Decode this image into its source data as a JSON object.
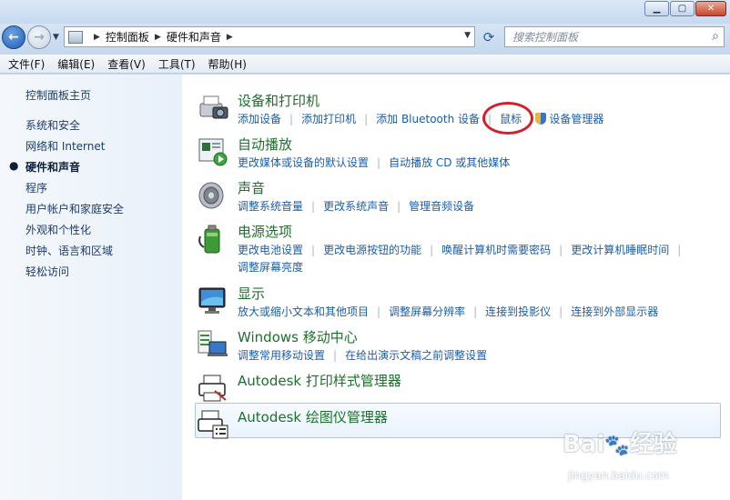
{
  "window": {
    "controls": [
      "minimize-icon",
      "maximize-icon",
      "close-icon"
    ]
  },
  "navbar": {
    "back_icon": "back-arrow-icon",
    "forward_icon": "forward-arrow-icon",
    "breadcrumb": [
      "控制面板",
      "硬件和声音"
    ],
    "search_placeholder": "搜索控制面板"
  },
  "menu": [
    "文件(F)",
    "编辑(E)",
    "查看(V)",
    "工具(T)",
    "帮助(H)"
  ],
  "sidebar": {
    "home": "控制面板主页",
    "items": [
      {
        "label": "系统和安全",
        "active": false
      },
      {
        "label": "网络和 Internet",
        "active": false
      },
      {
        "label": "硬件和声音",
        "active": true
      },
      {
        "label": "程序",
        "active": false
      },
      {
        "label": "用户帐户和家庭安全",
        "active": false
      },
      {
        "label": "外观和个性化",
        "active": false
      },
      {
        "label": "时钟、语言和区域",
        "active": false
      },
      {
        "label": "轻松访问",
        "active": false
      }
    ]
  },
  "categories": [
    {
      "title": "设备和打印机",
      "icon": "printer-camera-icon",
      "links": [
        "添加设备",
        "添加打印机",
        "添加 Bluetooth 设备",
        "鼠标",
        "设备管理器"
      ]
    },
    {
      "title": "自动播放",
      "icon": "autoplay-icon",
      "links": [
        "更改媒体或设备的默认设置",
        "自动播放 CD 或其他媒体"
      ]
    },
    {
      "title": "声音",
      "icon": "speaker-icon",
      "links": [
        "调整系统音量",
        "更改系统声音",
        "管理音频设备"
      ]
    },
    {
      "title": "电源选项",
      "icon": "battery-icon",
      "links": [
        "更改电池设置",
        "更改电源按钮的功能",
        "唤醒计算机时需要密码",
        "更改计算机睡眠时间",
        "调整屏幕亮度"
      ]
    },
    {
      "title": "显示",
      "icon": "monitor-icon",
      "links": [
        "放大或缩小文本和其他项目",
        "调整屏幕分辨率",
        "连接到投影仪",
        "连接到外部显示器"
      ]
    },
    {
      "title": "Windows 移动中心",
      "icon": "mobility-center-icon",
      "links": [
        "调整常用移动设置",
        "在给出演示文稿之前调整设置"
      ]
    },
    {
      "title": "Autodesk 打印样式管理器",
      "icon": "autodesk-print-style-icon",
      "links": []
    },
    {
      "title": "Autodesk 绘图仪管理器",
      "icon": "autodesk-plotter-icon",
      "links": []
    }
  ],
  "colors": {
    "category_title": "#1e6f2d",
    "link": "#1a5eab",
    "highlight_circle": "#d5202b"
  },
  "watermark": {
    "logo": "Bai du 经验",
    "url": "jingyan.baidu.com"
  }
}
